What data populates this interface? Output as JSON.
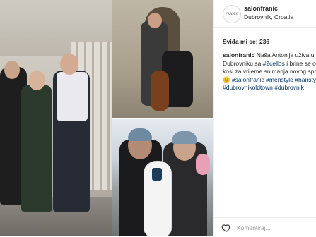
{
  "post": {
    "username": "salonfranic",
    "location": "Dubrovnik, Croatia",
    "avatar_text": "FRANIC",
    "likes": "Sviđa mi se: 236",
    "caption_lines": [
      {
        "parts": [
          {
            "t": "salonfranic",
            "c": "u"
          },
          {
            "t": " Naša Antonija uživa u",
            "c": ""
          }
        ]
      },
      {
        "parts": [
          {
            "t": "Dubrovniku sa ",
            "c": ""
          },
          {
            "t": "#2cellos",
            "c": "tag"
          },
          {
            "t": " i brine se o",
            "c": ""
          }
        ]
      },
      {
        "parts": [
          {
            "t": "kosi za vrijeme snimanja novog spo",
            "c": ""
          }
        ]
      },
      {
        "parts": [
          {
            "t": "😊 ",
            "c": ""
          },
          {
            "t": "#salonfranic",
            "c": "tag"
          },
          {
            "t": " ",
            "c": ""
          },
          {
            "t": "#menstyle",
            "c": "tag"
          },
          {
            "t": " ",
            "c": ""
          },
          {
            "t": "#hairstyl",
            "c": "tag"
          }
        ]
      },
      {
        "parts": [
          {
            "t": "#dubrovnikoldtown",
            "c": "tag"
          },
          {
            "t": " ",
            "c": ""
          },
          {
            "t": "#dubrovnik",
            "c": "tag"
          }
        ]
      }
    ],
    "comment_placeholder": "Komentiraj..."
  },
  "colors": {
    "text": "#262626",
    "hashtag": "#003569",
    "muted": "#999999",
    "divider": "#efefef"
  },
  "icons": {
    "like": "heart-icon"
  }
}
